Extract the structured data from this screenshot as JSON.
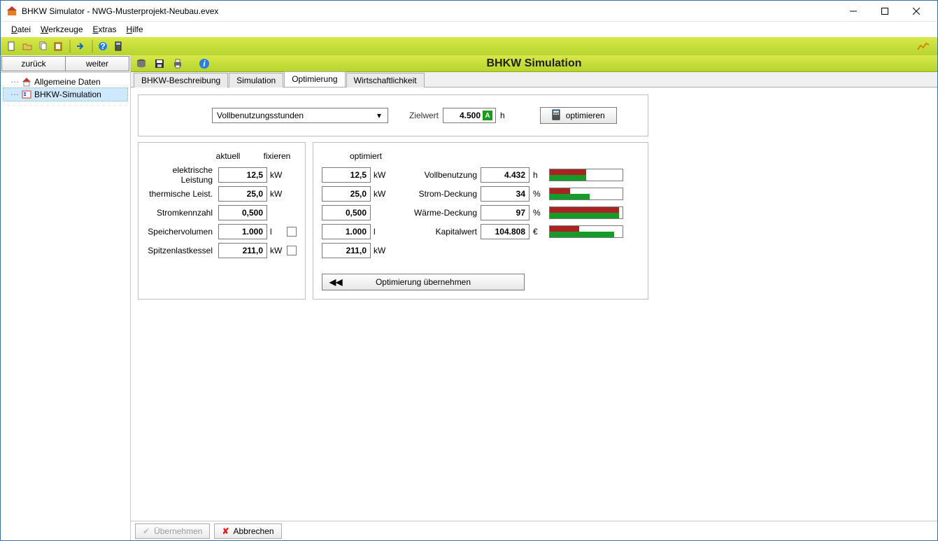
{
  "window": {
    "title": "BHKW Simulator - NWG-Musterprojekt-Neubau.evex"
  },
  "menu": {
    "datei": "Datei",
    "werkzeuge": "Werkzeuge",
    "extras": "Extras",
    "hilfe": "Hilfe"
  },
  "nav": {
    "back": "zurück",
    "forward": "weiter"
  },
  "tree": {
    "allgemeine": "Allgemeine Daten",
    "bhkw": "BHKW-Simulation"
  },
  "strip": {
    "title": "BHKW Simulation"
  },
  "tabs": {
    "t0": "BHKW-Beschreibung",
    "t1": "Simulation",
    "t2": "Optimierung",
    "t3": "Wirtschaftlichkeit"
  },
  "optTop": {
    "dropdown": "Vollbenutzungsstunden",
    "zielwert_label": "Zielwert",
    "zielwert_value": "4.500",
    "zielwert_unit": "h",
    "optimize_btn": "optimieren"
  },
  "left": {
    "hdr_aktuell": "aktuell",
    "hdr_fixieren": "fixieren",
    "rows": {
      "r0": {
        "label": "elektrische Leistung",
        "val": "12,5",
        "unit": "kW"
      },
      "r1": {
        "label": "thermische Leist.",
        "val": "25,0",
        "unit": "kW"
      },
      "r2": {
        "label": "Stromkennzahl",
        "val": "0,500",
        "unit": ""
      },
      "r3": {
        "label": "Speichervolumen",
        "val": "1.000",
        "unit": "l"
      },
      "r4": {
        "label": "Spitzenlastkessel",
        "val": "211,0",
        "unit": "kW"
      }
    }
  },
  "right": {
    "hdr_optimiert": "optimiert",
    "col1": {
      "r0": {
        "val": "12,5",
        "unit": "kW"
      },
      "r1": {
        "val": "25,0",
        "unit": "kW"
      },
      "r2": {
        "val": "0,500",
        "unit": ""
      },
      "r3": {
        "val": "1.000",
        "unit": "l"
      },
      "r4": {
        "val": "211,0",
        "unit": "kW"
      }
    },
    "res": {
      "r0": {
        "label": "Vollbenutzung",
        "val": "4.432",
        "unit": "h"
      },
      "r1": {
        "label": "Strom-Deckung",
        "val": "34",
        "unit": "%"
      },
      "r2": {
        "label": "Wärme-Deckung",
        "val": "97",
        "unit": "%"
      },
      "r3": {
        "label": "Kapitalwert",
        "val": "104.808",
        "unit": "€"
      }
    },
    "adopt": "Optimierung übernehmen"
  },
  "footer": {
    "ok": "Übernehmen",
    "cancel": "Abbrechen"
  },
  "chart_data": {
    "type": "bar",
    "note": "paired horizontal comparison bars (red=before, green=optimized); proportions estimated from pixels, scale unlabeled",
    "series": [
      {
        "name": "Vollbenutzung",
        "red": 50,
        "green": 50
      },
      {
        "name": "Strom-Deckung",
        "red": 28,
        "green": 55
      },
      {
        "name": "Wärme-Deckung",
        "red": 95,
        "green": 95
      },
      {
        "name": "Kapitalwert",
        "red": 40,
        "green": 88
      }
    ]
  }
}
